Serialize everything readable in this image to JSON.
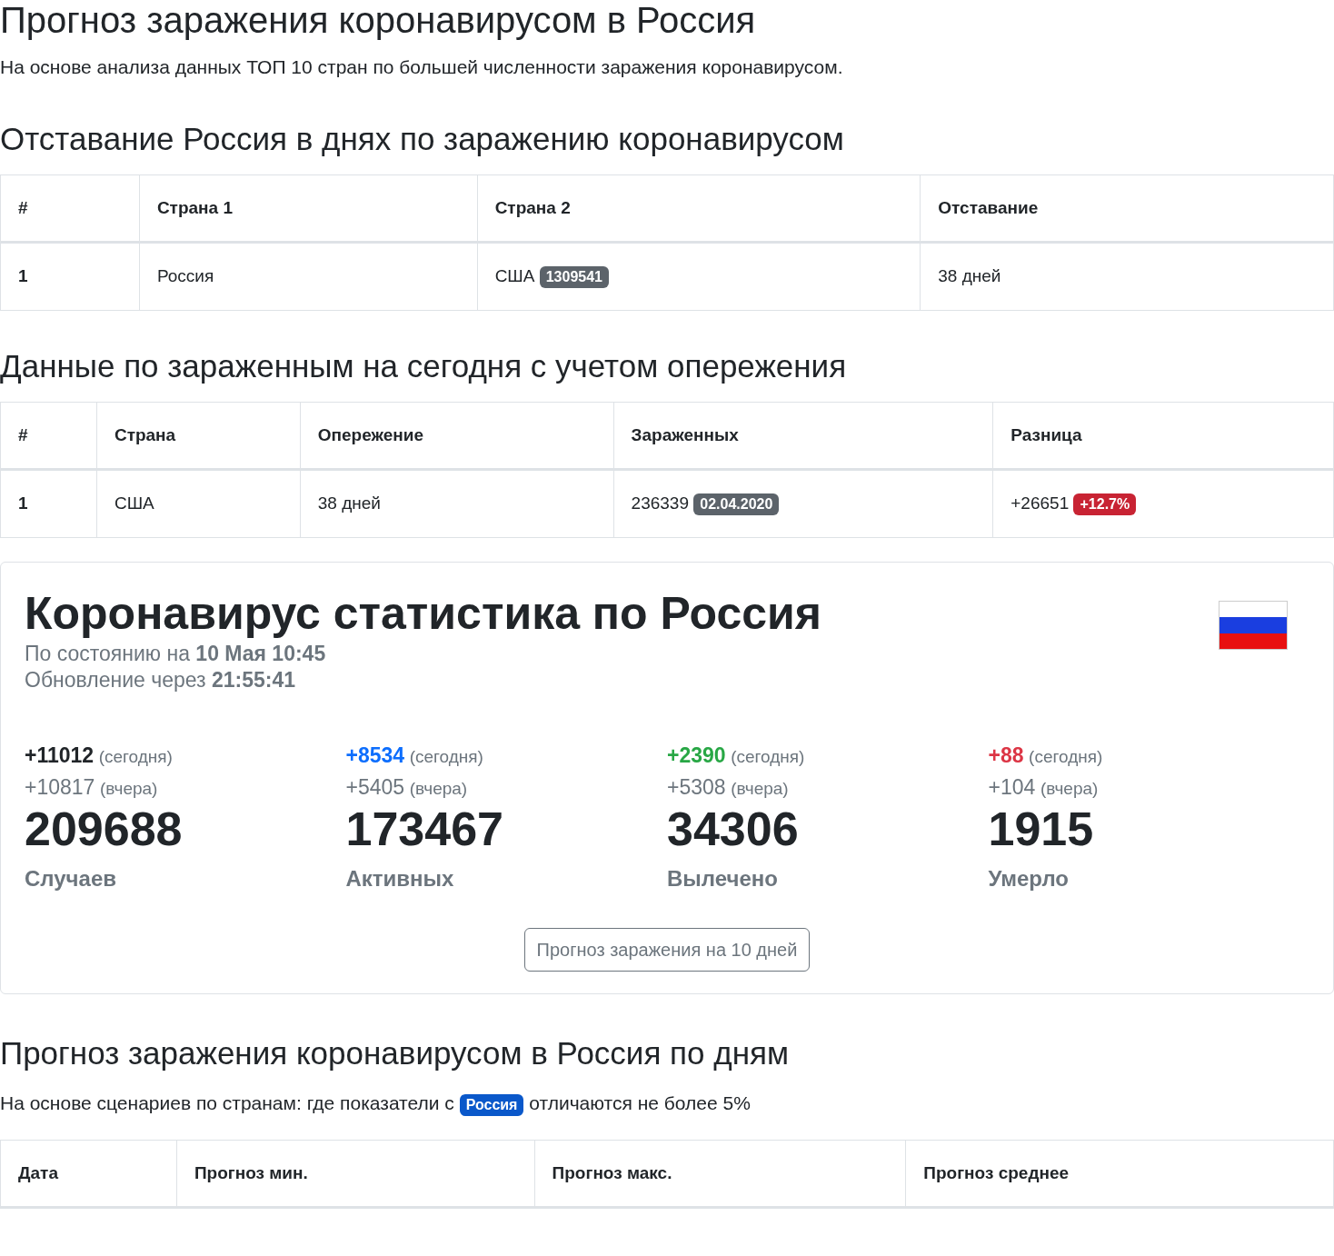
{
  "title": "Прогноз заражения коронавирусом в Россия",
  "subtitle": "На основе анализа данных ТОП 10 стран по большей численности заражения коронавирусом.",
  "lag_section": {
    "heading": "Отставание Россия в днях по заражению коронавирусом",
    "table": {
      "columns": [
        "#",
        "Страна 1",
        "Страна 2",
        "Отставание"
      ],
      "rows": [
        [
          {
            "text": "1"
          },
          {
            "text": "Россия"
          },
          {
            "text": "США",
            "badge": "1309541",
            "kind": "secondary"
          },
          {
            "text": "38 дней"
          }
        ]
      ]
    }
  },
  "today_section": {
    "heading": "Данные по зараженным на сегодня с учетом опережения",
    "table": {
      "columns": [
        "#",
        "Страна",
        "Опережение",
        "Зараженных",
        "Разница"
      ],
      "rows": [
        [
          {
            "text": "1"
          },
          {
            "text": "США"
          },
          {
            "text": "38 дней"
          },
          {
            "text": "236339",
            "badge": "02.04.2020",
            "kind": "secondary"
          },
          {
            "text": "+26651",
            "badge": "+12.7%",
            "kind": "danger"
          }
        ]
      ]
    }
  },
  "stats_card": {
    "title": "Коронавирус статистика по Россия",
    "status_lines": [
      "По состоянию на **10 Мая 10:45**",
      "Обновление через **21:55:41**"
    ],
    "stats": [
      {
        "today": "+11012",
        "today_note": "(сегодня)",
        "yesterday": "+10817",
        "yesterday_note": "(вчера)",
        "total": "209688",
        "label": "Случаев",
        "color": "#212529"
      },
      {
        "today": "+8534",
        "today_note": "(сегодня)",
        "yesterday": "+5405",
        "yesterday_note": "(вчера)",
        "total": "173467",
        "label": "Активных",
        "color": "#0d6efd"
      },
      {
        "today": "+2390",
        "today_note": "(сегодня)",
        "yesterday": "+5308",
        "yesterday_note": "(вчера)",
        "total": "34306",
        "label": "Вылечено",
        "color": "#28a745"
      },
      {
        "today": "+88",
        "today_note": "(сегодня)",
        "yesterday": "+104",
        "yesterday_note": "(вчера)",
        "total": "1915",
        "label": "Умерло",
        "color": "#dc3545"
      }
    ],
    "button": "Прогноз заражения на 10 дней"
  },
  "forecast_section": {
    "heading": "Прогноз заражения коронавирусом в Россия по дням",
    "note_before": "На основе сценариев по странам: где показатели с",
    "note_badge": "Россия",
    "note_after": "отличаются не более 5%",
    "table": {
      "columns": [
        "Дата",
        "Прогноз мин.",
        "Прогноз макс.",
        "Прогноз среднее"
      ]
    }
  }
}
